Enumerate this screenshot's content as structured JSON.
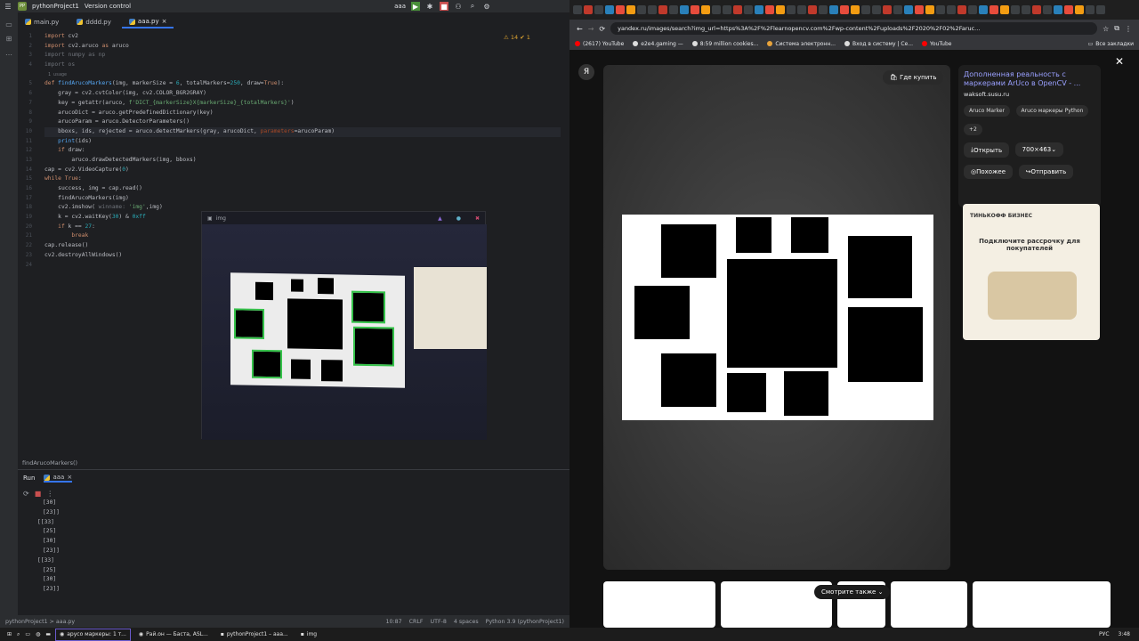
{
  "ide": {
    "project": "pythonProject1",
    "vcs": "Version control",
    "run_config": "aaa",
    "tabs": [
      {
        "label": "main.py"
      },
      {
        "label": "dddd.py"
      },
      {
        "label": "aaa.py"
      }
    ],
    "warning": "⚠ 14  ✔ 1",
    "usage_hint": "1 usage",
    "line_numbers": [
      "1",
      "2",
      "3",
      "4",
      "",
      "5",
      "6",
      "7",
      "8",
      "9",
      "10",
      "11",
      "12",
      "13",
      "14",
      "15",
      "16",
      "17",
      "18",
      "19",
      "20",
      "21",
      "22",
      "23",
      "24"
    ],
    "breadcrumb": "findArucoMarkers()",
    "run_label": "Run",
    "run_tab": "aaa",
    "run_output": [
      "[30]",
      "[23]]",
      "[[33]",
      "[25]",
      "[30]",
      "[23]]",
      "[[33]",
      "[25]",
      "[30]",
      "[23]]"
    ],
    "status_left": "pythonProject1 > aaa.py",
    "status_right": [
      "10:87",
      "CRLF",
      "UTF-8",
      "4 spaces",
      "Python 3.9 (pythonProject1)"
    ]
  },
  "imgwin": {
    "title": "img"
  },
  "browser": {
    "url": "yandex.ru/images/search?img_url=https%3A%2F%2Flearnopencv.com%2Fwp-content%2Fuploads%2F2020%2F02%2Faruc...",
    "bookmarks": [
      "(2617) YouTube",
      "e2e4.gaming —",
      "8:59 million cookies...",
      "Система электронн...",
      "Вход в систему | Се...",
      "YouTube"
    ],
    "all_bookmarks": "Все закладки",
    "buy": "Где купить",
    "side_title": "Дополненная реальность с маркерами ArUco в OpenCV - ...",
    "side_site": "waksoft.susu.ru",
    "chips": [
      "Aruco Marker",
      "Aruco маркеры Python",
      "+2"
    ],
    "open": "Открыть",
    "size": "700×463",
    "similar": "Похожее",
    "send": "Отправить",
    "ad_brand": "ТИНЬКОФФ БИЗНЕС",
    "ad_text": "Подключите рассрочку для покупателей",
    "see_also": "Смотрите также"
  },
  "taskbar": {
    "tasks": [
      "арусо маркеры: 1 т...",
      "Рай.он — Баста, ASL...",
      "pythonProject1 – aaa...",
      "img"
    ],
    "lang": "РУС",
    "time": "3:48"
  }
}
